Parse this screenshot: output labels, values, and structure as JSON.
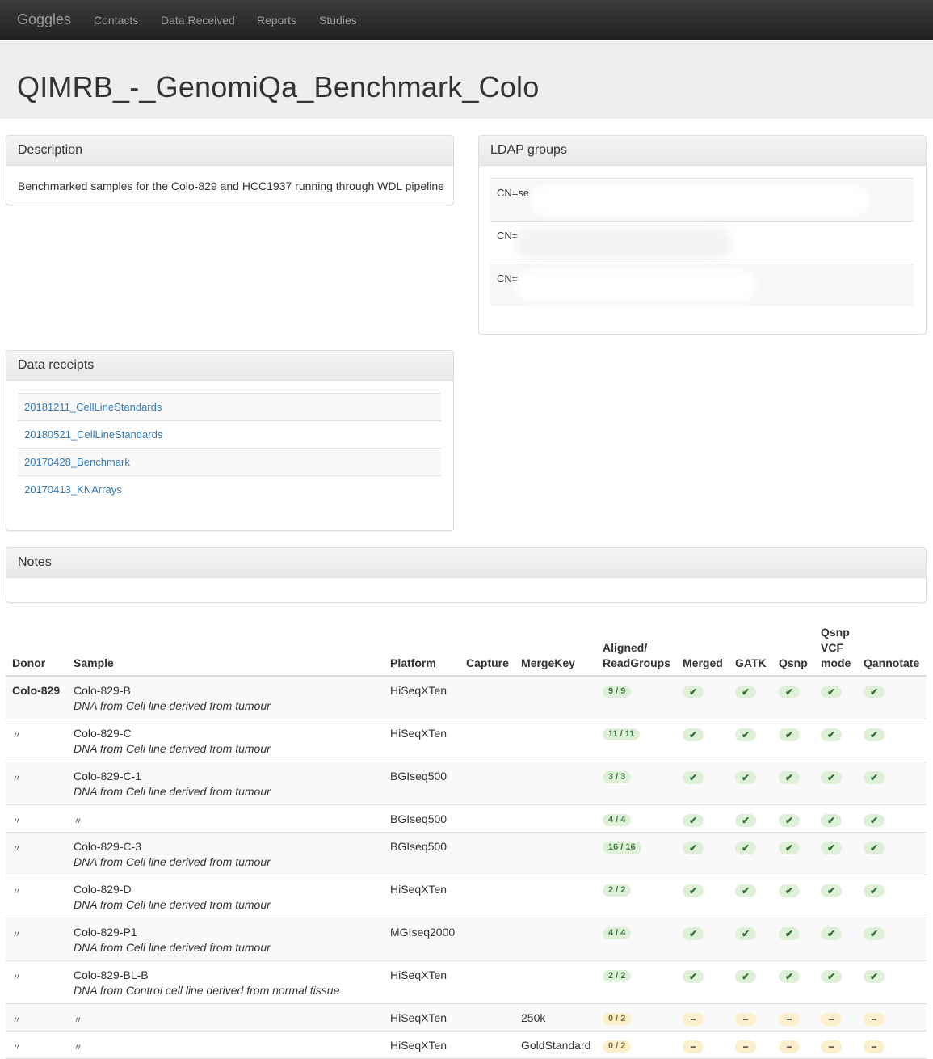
{
  "nav": {
    "brand": "Goggles",
    "links": [
      "Contacts",
      "Data Received",
      "Reports",
      "Studies"
    ]
  },
  "page_title": "QIMRB_-_GenomiQa_Benchmark_Colo",
  "description": {
    "heading": "Description",
    "text": "Benchmarked samples for the Colo-829 and HCC1937 running through WDL pipeline"
  },
  "ldap": {
    "heading": "LDAP groups",
    "items": [
      "CN=se",
      "CN=",
      "CN="
    ]
  },
  "receipts": {
    "heading": "Data receipts",
    "items": [
      "20181211_CellLineStandards",
      "20180521_CellLineStandards",
      "20170428_Benchmark",
      "20170413_KNArrays"
    ]
  },
  "notes": {
    "heading": "Notes"
  },
  "table": {
    "headers": {
      "donor": "Donor",
      "sample": "Sample",
      "platform": "Platform",
      "capture": "Capture",
      "mergekey": "MergeKey",
      "aligned_1": "Aligned/",
      "aligned_2": "ReadGroups",
      "merged": "Merged",
      "gatk": "GATK",
      "qsnp": "Qsnp",
      "qsnp_vcf_1": "Qsnp",
      "qsnp_vcf_2": "VCF",
      "qsnp_vcf_3": "mode",
      "qannotate": "Qannotate"
    },
    "rows": [
      {
        "donor": "Colo-829",
        "sample": "Colo-829-B",
        "desc": "DNA from Cell line derived from tumour",
        "platform": "HiSeqXTen",
        "capture": "",
        "mergekey": "",
        "aligned": "9 / 9",
        "state": "ok"
      },
      {
        "donor": "〃",
        "sample": "Colo-829-C",
        "desc": "DNA from Cell line derived from tumour",
        "platform": "HiSeqXTen",
        "capture": "",
        "mergekey": "",
        "aligned": "11 / 11",
        "state": "ok"
      },
      {
        "donor": "〃",
        "sample": "Colo-829-C-1",
        "desc": "DNA from Cell line derived from tumour",
        "platform": "BGIseq500",
        "capture": "",
        "mergekey": "",
        "aligned": "3 / 3",
        "state": "ok"
      },
      {
        "donor": "〃",
        "sample": "〃",
        "desc": "",
        "platform": "BGIseq500",
        "capture": "",
        "mergekey": "",
        "aligned": "4 / 4",
        "state": "ok"
      },
      {
        "donor": "〃",
        "sample": "Colo-829-C-3",
        "desc": "DNA from Cell line derived from tumour",
        "platform": "BGIseq500",
        "capture": "",
        "mergekey": "",
        "aligned": "16 / 16",
        "state": "ok"
      },
      {
        "donor": "〃",
        "sample": "Colo-829-D",
        "desc": "DNA from Cell line derived from tumour",
        "platform": "HiSeqXTen",
        "capture": "",
        "mergekey": "",
        "aligned": "2 / 2",
        "state": "ok"
      },
      {
        "donor": "〃",
        "sample": "Colo-829-P1",
        "desc": "DNA from Cell line derived from tumour",
        "platform": "MGIseq2000",
        "capture": "",
        "mergekey": "",
        "aligned": "4 / 4",
        "state": "ok"
      },
      {
        "donor": "〃",
        "sample": "Colo-829-BL-B",
        "desc": "DNA from Control cell line derived from normal tissue",
        "platform": "HiSeqXTen",
        "capture": "",
        "mergekey": "",
        "aligned": "2 / 2",
        "state": "ok"
      },
      {
        "donor": "〃",
        "sample": "〃",
        "desc": "",
        "platform": "HiSeqXTen",
        "capture": "",
        "mergekey": "250k",
        "aligned": "0 / 2",
        "state": "warn"
      },
      {
        "donor": "〃",
        "sample": "〃",
        "desc": "",
        "platform": "HiSeqXTen",
        "capture": "",
        "mergekey": "GoldStandard",
        "aligned": "0 / 2",
        "state": "warn"
      }
    ]
  },
  "icons": {
    "ok": "✔",
    "warn": "−"
  },
  "colors": {
    "link": "#337ab7",
    "ok_bg": "#dff0d8",
    "warn_bg": "#fcf0cc"
  }
}
